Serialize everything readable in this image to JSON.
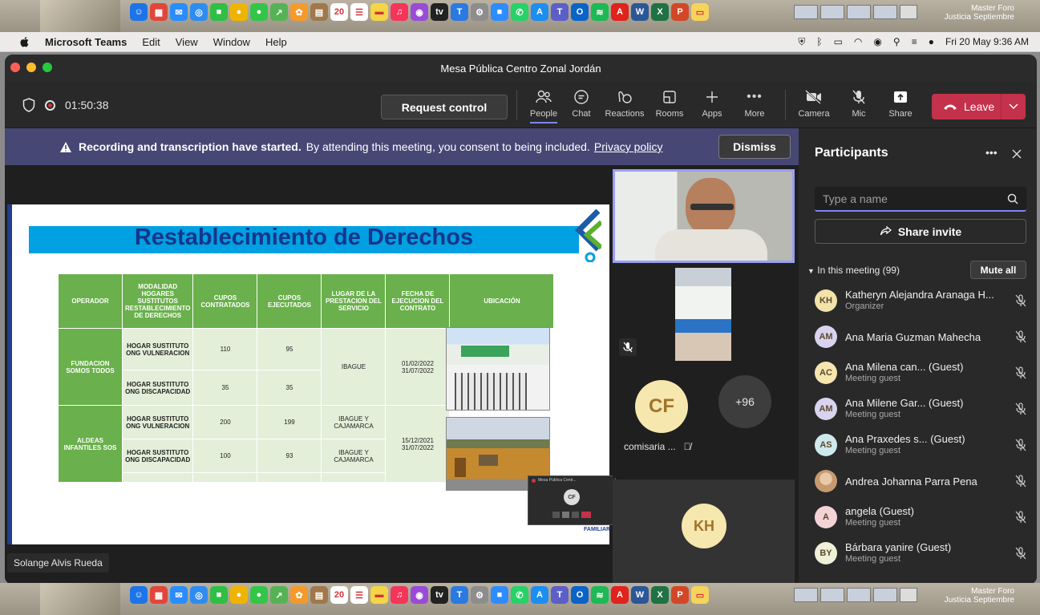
{
  "dock": {
    "label_line1": "Master Foro",
    "label_line2": "Justicia Septiembre",
    "apps": [
      {
        "icon": "finder-icon",
        "color": "#1d74e8",
        "glyph": "☺"
      },
      {
        "icon": "launchpad-icon",
        "color": "#e0463c",
        "glyph": "▦"
      },
      {
        "icon": "mail-icon",
        "color": "#2a8cff",
        "glyph": "✉"
      },
      {
        "icon": "safari-icon",
        "color": "#2e8cf0",
        "glyph": "◎"
      },
      {
        "icon": "facetime-icon",
        "color": "#2fbf44",
        "glyph": "■"
      },
      {
        "icon": "chrome-icon",
        "color": "#f0b400",
        "glyph": "●"
      },
      {
        "icon": "messages-icon",
        "color": "#33c548",
        "glyph": "●"
      },
      {
        "icon": "maps-icon",
        "color": "#55b356",
        "glyph": "↗"
      },
      {
        "icon": "photos-icon",
        "color": "#f39a2b",
        "glyph": "✿"
      },
      {
        "icon": "notes-icon",
        "color": "#a0784a",
        "glyph": "▤"
      },
      {
        "icon": "calendar-icon",
        "color": "#ffffff",
        "glyph": "20"
      },
      {
        "icon": "reminders-icon",
        "color": "#ffffff",
        "glyph": "☰"
      },
      {
        "icon": "notes-yellow-icon",
        "color": "#f5d445",
        "glyph": "▬"
      },
      {
        "icon": "music-icon",
        "color": "#f5345a",
        "glyph": "♫"
      },
      {
        "icon": "podcasts-icon",
        "color": "#9a4bd6",
        "glyph": "◉"
      },
      {
        "icon": "tv-icon",
        "color": "#222222",
        "glyph": "tv"
      },
      {
        "icon": "keynote-icon",
        "color": "#2a7ae2",
        "glyph": "T"
      },
      {
        "icon": "settings-icon",
        "color": "#8d8d8d",
        "glyph": "⚙"
      },
      {
        "icon": "zoom-icon",
        "color": "#2d8cff",
        "glyph": "■"
      },
      {
        "icon": "whatsapp-icon",
        "color": "#25d366",
        "glyph": "✆"
      },
      {
        "icon": "appstore-icon",
        "color": "#1c8ef0",
        "glyph": "A"
      },
      {
        "icon": "teams-icon",
        "color": "#5b5fc7",
        "glyph": "T"
      },
      {
        "icon": "outlook-icon",
        "color": "#0a64c8",
        "glyph": "O"
      },
      {
        "icon": "spotify-icon",
        "color": "#1db954",
        "glyph": "≋"
      },
      {
        "icon": "acrobat-icon",
        "color": "#e0231b",
        "glyph": "A"
      },
      {
        "icon": "word-icon",
        "color": "#2b5797",
        "glyph": "W"
      },
      {
        "icon": "excel-icon",
        "color": "#1f7244",
        "glyph": "X"
      },
      {
        "icon": "powerpoint-icon",
        "color": "#d24726",
        "glyph": "P"
      },
      {
        "icon": "folder-icon",
        "color": "#f6d35a",
        "glyph": "▭"
      }
    ]
  },
  "menubar": {
    "app": "Microsoft Teams",
    "items": [
      "Edit",
      "View",
      "Window",
      "Help"
    ],
    "datetime": "Fri 20 May  9:36 AM"
  },
  "window": {
    "title": "Mesa Pública Centro Zonal Jordán"
  },
  "toolbar": {
    "timer": "01:50:38",
    "request_control": "Request control",
    "buttons": {
      "people": "People",
      "chat": "Chat",
      "reactions": "Reactions",
      "rooms": "Rooms",
      "apps": "Apps",
      "more": "More",
      "camera": "Camera",
      "mic": "Mic",
      "share": "Share"
    },
    "leave": "Leave"
  },
  "banner": {
    "bold": "Recording and transcription have started.",
    "text": "By attending this meeting, you consent to being included.",
    "link": "Privacy policy",
    "dismiss": "Dismiss"
  },
  "slide": {
    "title": "Restablecimiento de Derechos",
    "headers": [
      "OPERADOR",
      "MODALIDAD HOGARES SUSTITUTOS RESTABLECIMIENTO DE DERECHOS",
      "CUPOS CONTRATADOS",
      "CUPOS EJECUTADOS",
      "LUGAR DE LA PRESTACION DEL SERVICIO",
      "FECHA DE EJECUCION DEL CONTRATO",
      "UBICACIÓN"
    ],
    "operators": [
      "FUNDACION SOMOS TODOS",
      "ALDEAS INFANTILES SOS"
    ],
    "rows": [
      {
        "modalidad": "HOGAR SUSTITUTO ONG VULNERACION",
        "contratados": "110",
        "ejecutados": "95"
      },
      {
        "modalidad": "HOGAR SUSTITUTO ONG DISCAPACIDAD",
        "contratados": "35",
        "ejecutados": "35"
      },
      {
        "modalidad": "HOGAR SUSTITUTO ONG VULNERACION",
        "contratados": "200",
        "ejecutados": "199"
      },
      {
        "modalidad": "HOGAR SUSTITUTO ONG DISCAPACIDAD",
        "contratados": "100",
        "ejecutados": "93"
      }
    ],
    "lugar": [
      "IBAGUE",
      "IBAGUE Y CAJAMARCA",
      "IBAGUE Y CAJAMARCA"
    ],
    "fechas": [
      "01/02/2022 31/07/2022",
      "15/12/2021 31/07/2022"
    ],
    "footer": "FAMILIAR"
  },
  "mini_window": {
    "title": "Mesa Pública Centr...",
    "avatar": "CF"
  },
  "stage": {
    "presenter": "Solange Alvis Rueda"
  },
  "tiles": {
    "cf_initials": "CF",
    "cf_name": "comisaria ...",
    "more_count": "+96",
    "kh_initials": "KH"
  },
  "panel": {
    "title": "Participants",
    "search_placeholder": "Type a name",
    "share_invite": "Share invite",
    "section": "In this meeting (99)",
    "mute_all": "Mute all",
    "participants": [
      {
        "initials": "KH",
        "name": "Katheryn Alejandra Aranaga H...",
        "sub": "Organizer",
        "color": "#f3e3a9"
      },
      {
        "initials": "AM",
        "name": "Ana Maria Guzman Mahecha",
        "sub": "",
        "color": "#d9d3f0"
      },
      {
        "initials": "AC",
        "name": "Ana Milena can...  (Guest)",
        "sub": "Meeting guest",
        "color": "#f5e6b0"
      },
      {
        "initials": "AM",
        "name": "Ana Milene Gar...  (Guest)",
        "sub": "Meeting guest",
        "color": "#d9d3f0"
      },
      {
        "initials": "AS",
        "name": "Ana Praxedes s...  (Guest)",
        "sub": "Meeting guest",
        "color": "#cfe8ec"
      },
      {
        "initials": "",
        "name": "Andrea Johanna Parra Pena",
        "sub": "",
        "color": "#c79a6e"
      },
      {
        "initials": "A",
        "name": "angela (Guest)",
        "sub": "Meeting guest",
        "color": "#f3d3d6"
      },
      {
        "initials": "BY",
        "name": "Bárbara yanire (Guest)",
        "sub": "Meeting guest",
        "color": "#eef0d8"
      }
    ]
  }
}
